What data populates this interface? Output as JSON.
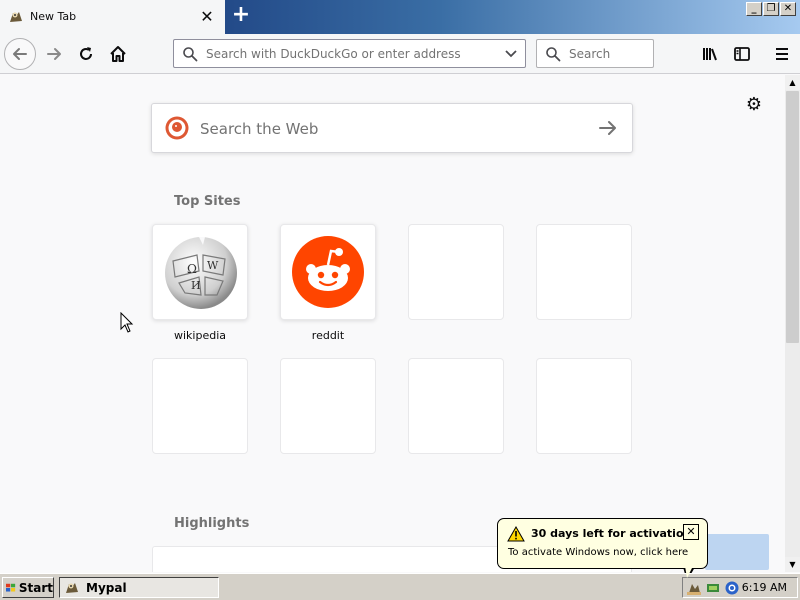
{
  "browser": {
    "tab": {
      "title": "New Tab",
      "close_glyph": "✕"
    },
    "new_tab_glyph": "+",
    "window_buttons": [
      "_",
      "❐",
      "✕"
    ],
    "urlbar": {
      "placeholder": "Search with DuckDuckGo or enter address",
      "value": ""
    },
    "searchbar": {
      "placeholder": "Search",
      "value": ""
    },
    "toolbar_icons": [
      "back-icon",
      "forward-icon",
      "reload-icon",
      "home-icon",
      "library-icon",
      "sidebar-icon",
      "menu-icon"
    ]
  },
  "newtab": {
    "settings_icon": "gear-icon",
    "web_search": {
      "placeholder": "Search the Web",
      "engine_icon": "duckduckgo-icon"
    },
    "top_sites_title": "Top Sites",
    "top_sites": [
      {
        "label": "wikipedia",
        "icon": "wikipedia-globe-icon"
      },
      {
        "label": "reddit",
        "icon": "reddit-alien-icon"
      },
      {
        "label": ""
      },
      {
        "label": ""
      },
      {
        "label": ""
      },
      {
        "label": ""
      },
      {
        "label": ""
      },
      {
        "label": ""
      }
    ],
    "highlights_title": "Highlights"
  },
  "balloon": {
    "title": "30 days left for activation",
    "message": "To activate Windows now, click here",
    "close_glyph": "✕",
    "icon": "warning-icon"
  },
  "taskbar": {
    "start_label": "Start",
    "task_label": "Mypal",
    "clock": "6:19 AM",
    "tray_icons": [
      "tray-network-icon",
      "tray-app-icon",
      "tray-shield-icon"
    ]
  },
  "colors": {
    "reddit": "#ff4500",
    "ddg": "#de5833",
    "title_gradient_start": "#0a246a",
    "title_gradient_end": "#a6caf0",
    "balloon_bg": "#ffffe1",
    "taskbar": "#d4d0c8"
  }
}
